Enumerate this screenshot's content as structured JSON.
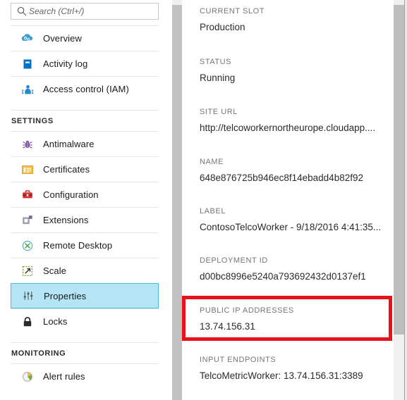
{
  "search": {
    "placeholder": "Search (Ctrl+/)",
    "value": "",
    "icon": "search-icon"
  },
  "sidebar": {
    "items": [
      {
        "label": "Overview",
        "icon": "overview-icon",
        "selected": false
      },
      {
        "label": "Activity log",
        "icon": "activity-log-icon",
        "selected": false
      },
      {
        "label": "Access control (IAM)",
        "icon": "access-control-icon",
        "selected": false
      }
    ],
    "groups": [
      {
        "title": "SETTINGS",
        "items": [
          {
            "label": "Antimalware",
            "icon": "antimalware-bug-icon",
            "selected": false
          },
          {
            "label": "Certificates",
            "icon": "certificate-icon",
            "selected": false
          },
          {
            "label": "Configuration",
            "icon": "configuration-toolbox-icon",
            "selected": false
          },
          {
            "label": "Extensions",
            "icon": "extensions-icon",
            "selected": false
          },
          {
            "label": "Remote Desktop",
            "icon": "remote-desktop-icon",
            "selected": false
          },
          {
            "label": "Scale",
            "icon": "scale-icon",
            "selected": false
          },
          {
            "label": "Properties",
            "icon": "properties-sliders-icon",
            "selected": true
          },
          {
            "label": "Locks",
            "icon": "lock-icon",
            "selected": false
          }
        ]
      },
      {
        "title": "MONITORING",
        "items": [
          {
            "label": "Alert rules",
            "icon": "alert-rules-icon",
            "selected": false
          }
        ]
      }
    ]
  },
  "content": {
    "properties": [
      {
        "label": "CURRENT SLOT",
        "value": "Production"
      },
      {
        "label": "STATUS",
        "value": "Running"
      },
      {
        "label": "SITE URL",
        "value": "http://telcoworkernortheurope.cloudapp...."
      },
      {
        "label": "NAME",
        "value": "648e876725b946ec8f14ebadd4b82f92"
      },
      {
        "label": "LABEL",
        "value": "ContosoTelcoWorker - 9/18/2016 4:41:35..."
      },
      {
        "label": "DEPLOYMENT ID",
        "value": "d00bc8996e5240a793692432d0137ef1"
      },
      {
        "label": "PUBLIC IP ADDRESSES",
        "value": "13.74.156.31"
      },
      {
        "label": "INPUT ENDPOINTS",
        "value": "TelcoMetricWorker: 13.74.156.31:3389"
      }
    ]
  },
  "annotation": {
    "highlight_color": "#e8131a",
    "highlights_property": "PUBLIC IP ADDRESSES"
  },
  "colors": {
    "selected_row_background": "#b3e5f5",
    "selected_row_border": "#4bb8dd",
    "azure_blue": "#0072c6",
    "label_gray": "#767676"
  }
}
